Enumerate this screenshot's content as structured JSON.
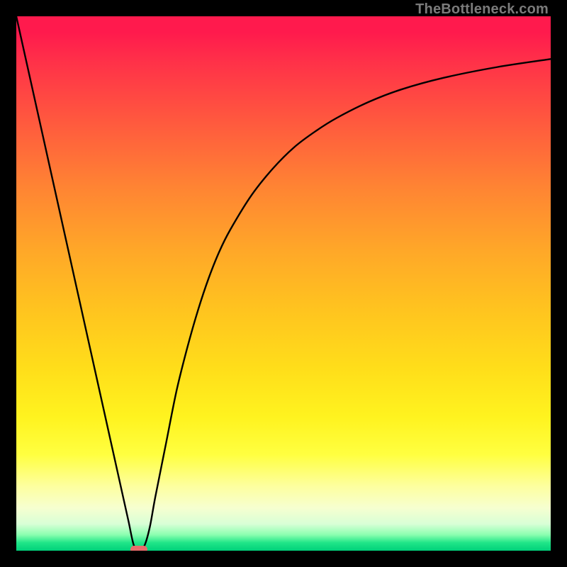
{
  "watermark": "TheBottleneck.com",
  "colors": {
    "page_bg": "#000000",
    "marker": "#e86b6b",
    "curve_stroke": "#000000"
  },
  "chart_data": {
    "type": "line",
    "title": "",
    "xlabel": "",
    "ylabel": "",
    "xlim": [
      0,
      100
    ],
    "ylim": [
      0,
      100
    ],
    "grid": false,
    "legend": null,
    "series": [
      {
        "name": "bottleneck-curve",
        "x": [
          0,
          2,
          4,
          6,
          8,
          10,
          12,
          14,
          16,
          18,
          20,
          21,
          22,
          23,
          24,
          25,
          26,
          28,
          30,
          32,
          34,
          36,
          38,
          40,
          44,
          48,
          52,
          56,
          60,
          66,
          72,
          80,
          90,
          100
        ],
        "y": [
          100,
          91,
          82,
          73,
          64,
          55,
          46,
          37,
          28,
          19,
          10,
          5.5,
          1.0,
          0.2,
          1.0,
          4.5,
          10,
          20,
          30,
          38,
          45,
          51,
          56,
          60,
          66.5,
          71.5,
          75.5,
          78.5,
          81,
          84,
          86.3,
          88.5,
          90.5,
          92
        ]
      }
    ],
    "marker": {
      "x": 23,
      "y": 0.2
    }
  }
}
